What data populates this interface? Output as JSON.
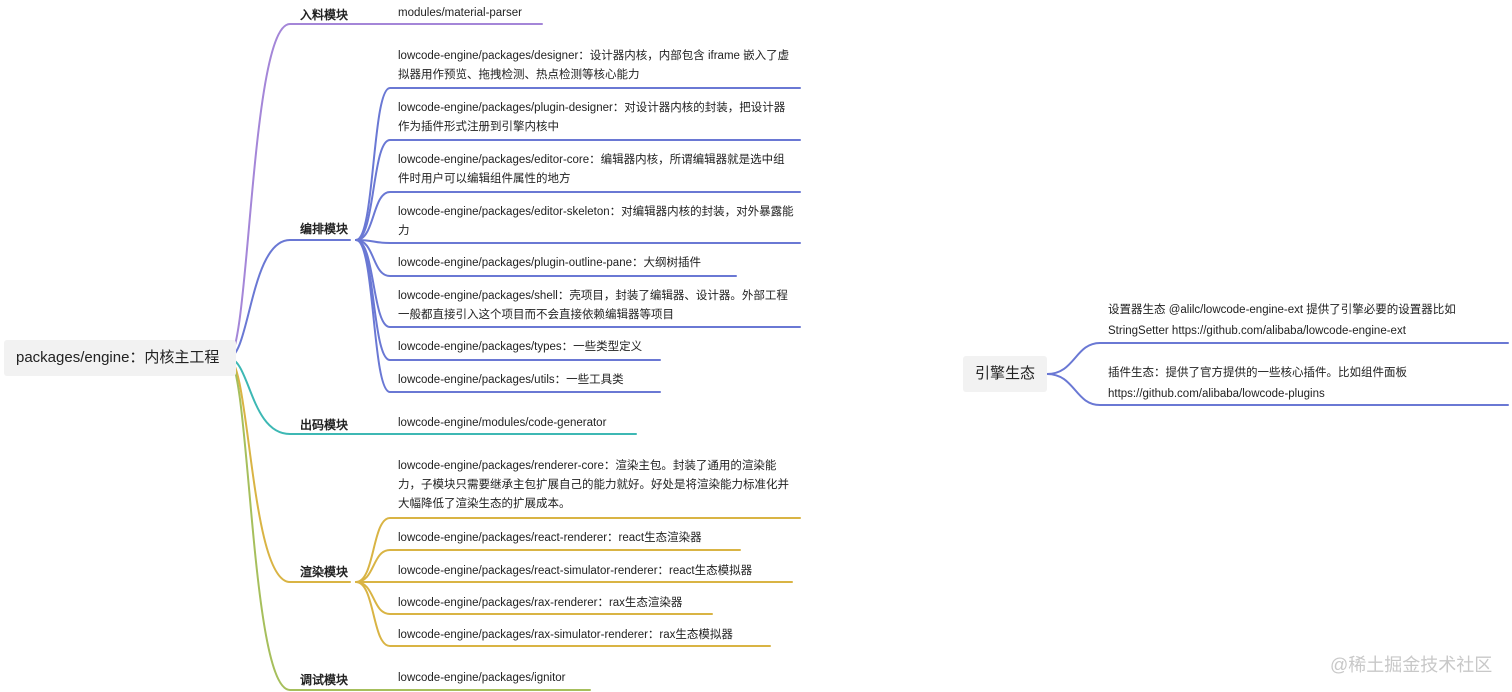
{
  "colors": {
    "purple": "#a486d8",
    "blue": "#6a78d4",
    "teal": "#3db8b4",
    "gold": "#d9b444",
    "olive": "#a6bf5c",
    "root_bg": "#f2f2f2"
  },
  "root": {
    "label": "packages/engine：内核主工程"
  },
  "branches": [
    {
      "label": "入料模块",
      "leaves": [
        "modules/material-parser"
      ]
    },
    {
      "label": "编排模块",
      "leaves": [
        "lowcode-engine/packages/designer：设计器内核，内部包含 iframe 嵌入了虚拟器用作预览、拖拽检测、热点检测等核心能力",
        "lowcode-engine/packages/plugin-designer：对设计器内核的封装，把设计器作为插件形式注册到引擎内核中",
        "lowcode-engine/packages/editor-core：编辑器内核，所谓编辑器就是选中组件时用户可以编辑组件属性的地方",
        "lowcode-engine/packages/editor-skeleton：对编辑器内核的封装，对外暴露能力",
        "lowcode-engine/packages/plugin-outline-pane：大纲树插件",
        "lowcode-engine/packages/shell：壳项目，封装了编辑器、设计器。外部工程一般都直接引入这个项目而不会直接依赖编辑器等项目",
        "lowcode-engine/packages/types：一些类型定义",
        "lowcode-engine/packages/utils：一些工具类"
      ]
    },
    {
      "label": "出码模块",
      "leaves": [
        "lowcode-engine/modules/code-generator"
      ]
    },
    {
      "label": "渲染模块",
      "leaves": [
        "lowcode-engine/packages/renderer-core：渲染主包。封装了通用的渲染能力，子模块只需要继承主包扩展自己的能力就好。好处是将渲染能力标准化并大幅降低了渲染生态的扩展成本。",
        "lowcode-engine/packages/react-renderer：react生态渲染器",
        "lowcode-engine/packages/react-simulator-renderer：react生态模拟器",
        "lowcode-engine/packages/rax-renderer：rax生态渲染器",
        "lowcode-engine/packages/rax-simulator-renderer：rax生态模拟器"
      ]
    },
    {
      "label": "调试模块",
      "leaves": [
        "lowcode-engine/packages/ignitor"
      ]
    }
  ],
  "root2": {
    "label": "引擎生态",
    "leaves": [
      "设置器生态 @alilc/lowcode-engine-ext  提供了引擎必要的设置器比如StringSetter https://github.com/alibaba/lowcode-engine-ext",
      "插件生态：提供了官方提供的一些核心插件。比如组件面板 https://github.com/alibaba/lowcode-plugins"
    ]
  },
  "watermark": "@稀土掘金技术社区"
}
